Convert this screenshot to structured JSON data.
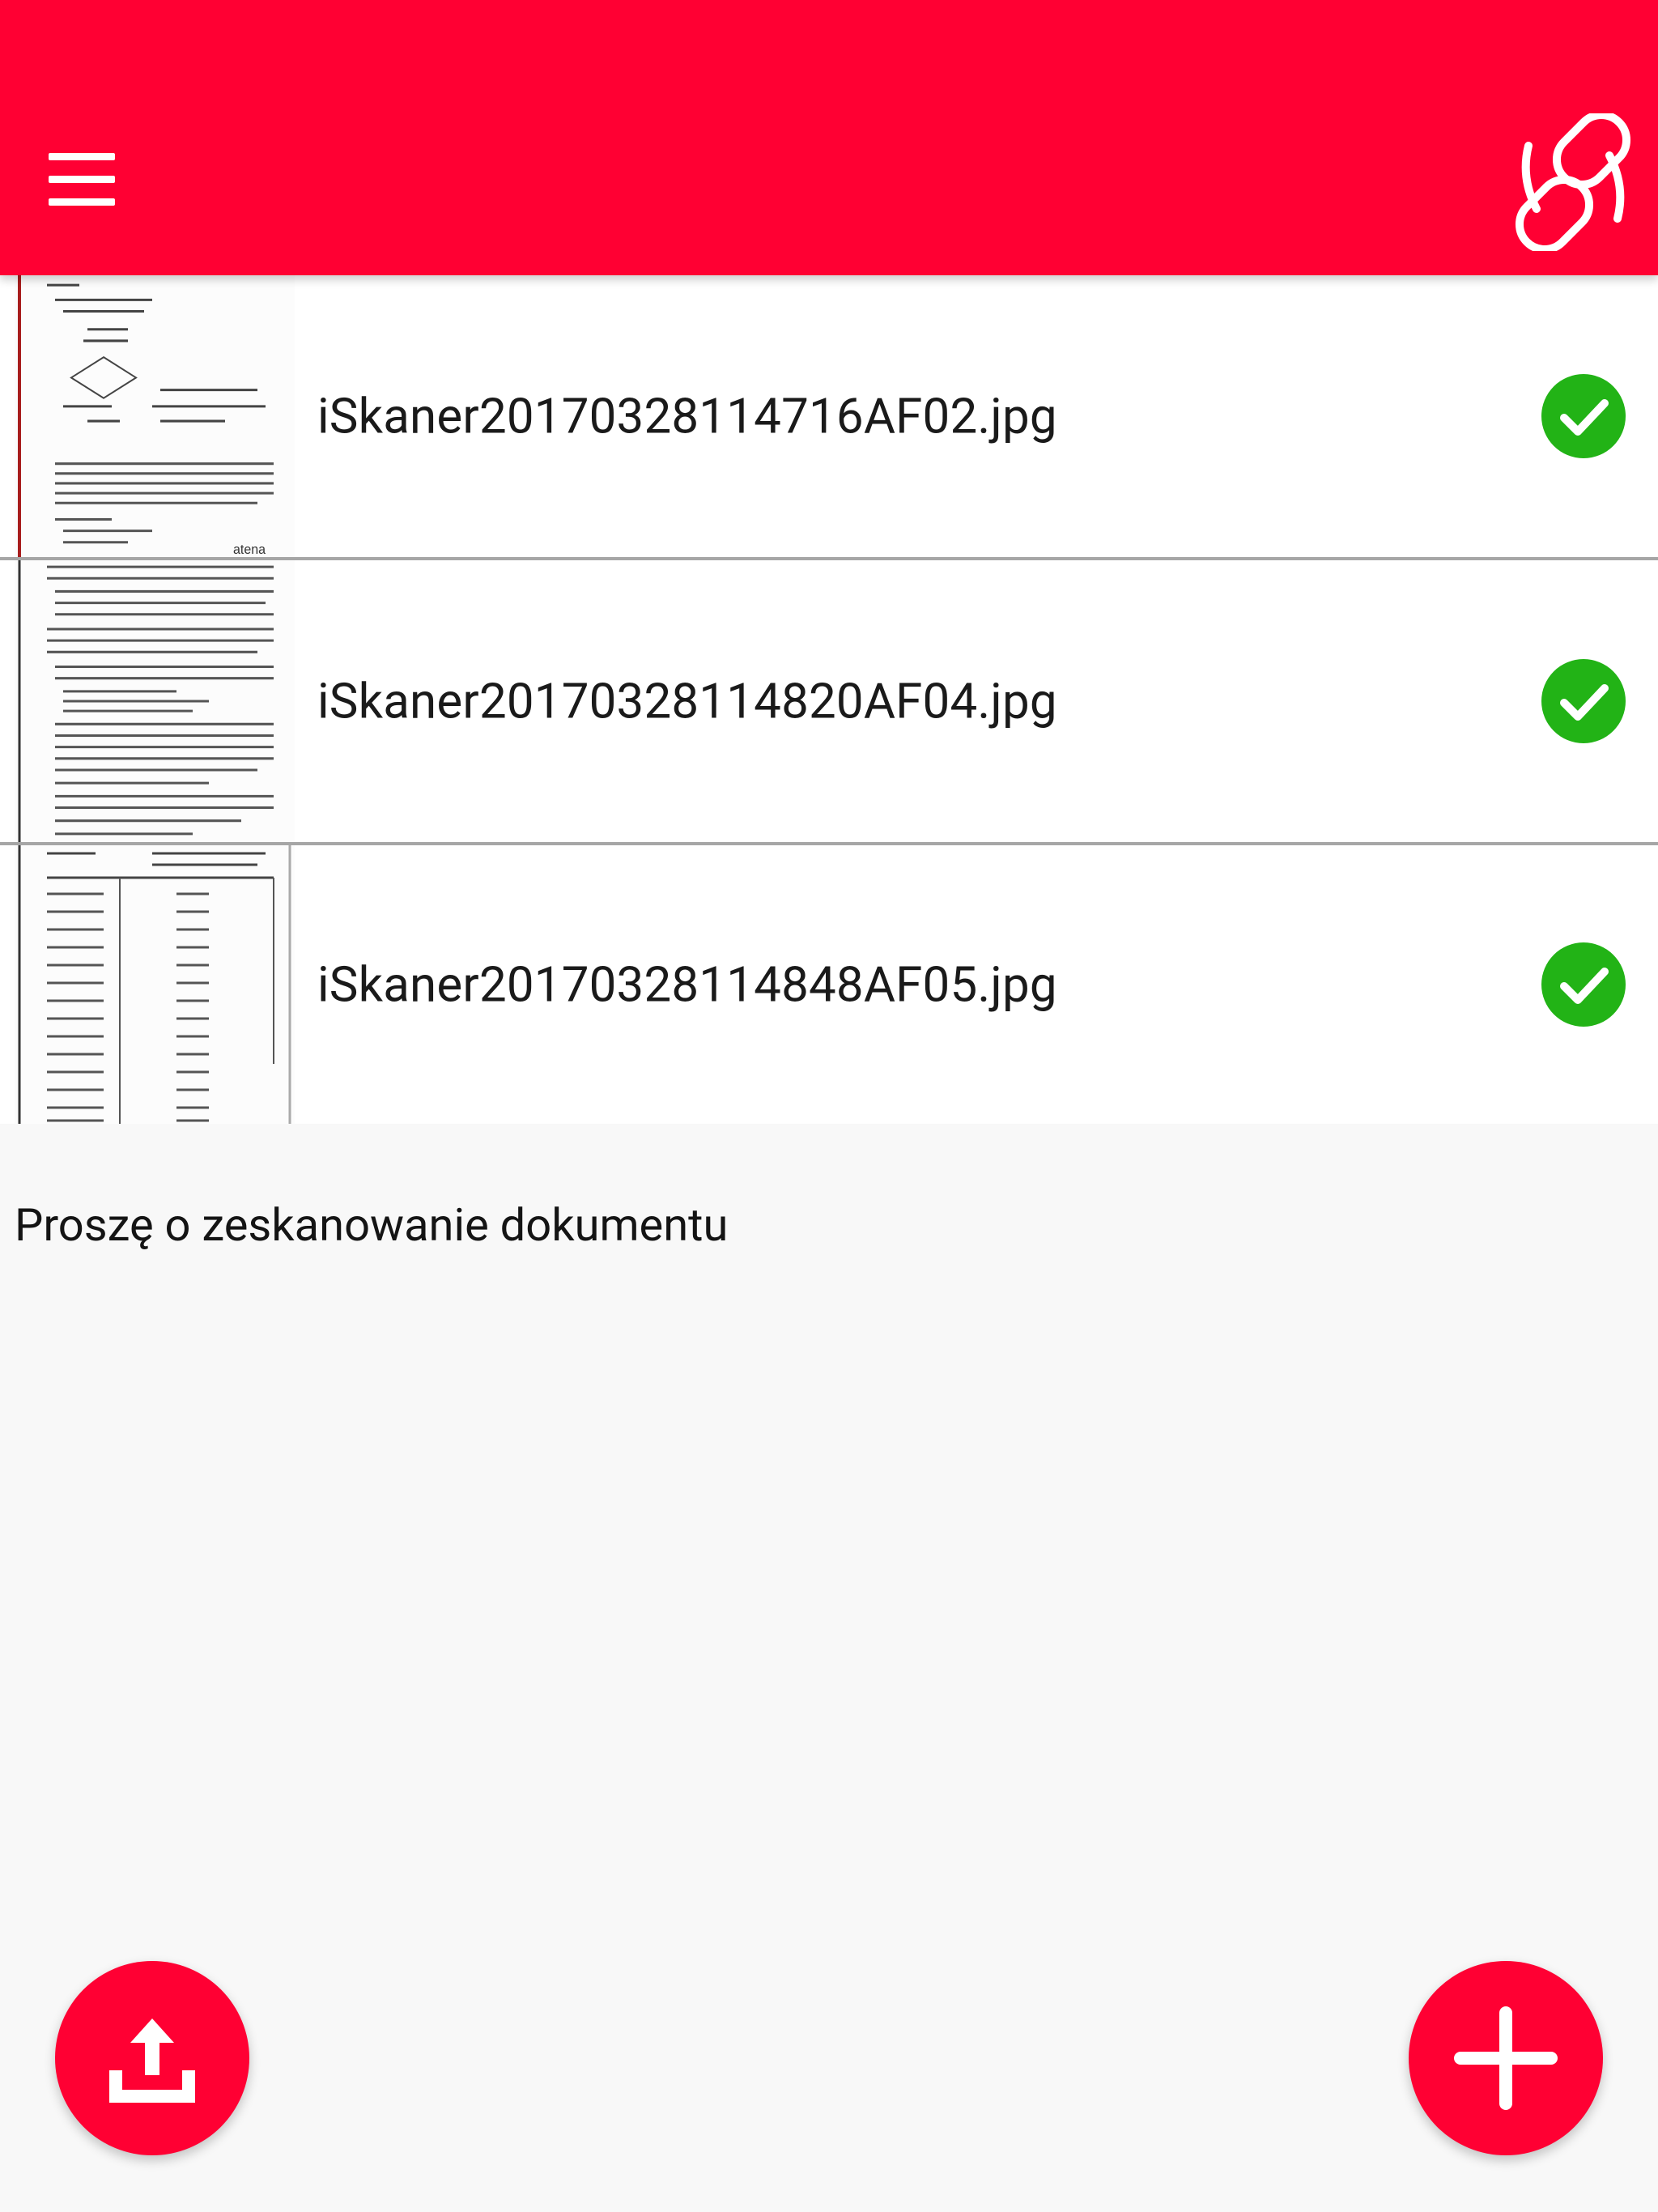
{
  "appbar": {
    "menu_icon": "hamburger-menu-icon",
    "link_icon": "broken-link-icon",
    "color": "#ff0033"
  },
  "files": [
    {
      "name": "iSkaner20170328114716AF02.jpg",
      "status": "uploaded",
      "status_icon": "check-circle-icon",
      "thumb_caption": "atena"
    },
    {
      "name": "iSkaner20170328114820AF04.jpg",
      "status": "uploaded",
      "status_icon": "check-circle-icon"
    },
    {
      "name": "iSkaner20170328114848AF05.jpg",
      "status": "uploaded",
      "status_icon": "check-circle-icon"
    }
  ],
  "hint_text": "Proszę o zeskanowanie dokumentu",
  "actions": {
    "upload_icon": "upload-icon",
    "add_icon": "plus-icon"
  },
  "colors": {
    "accent": "#ff0033",
    "success": "#22b316"
  }
}
